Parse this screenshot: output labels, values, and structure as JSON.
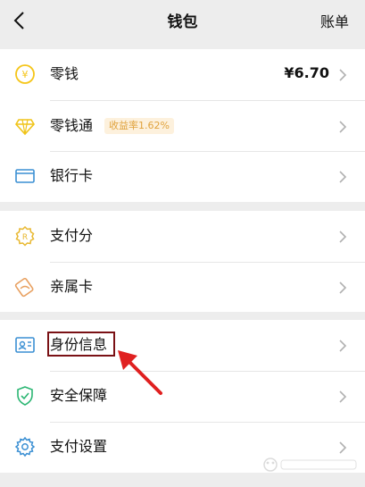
{
  "header": {
    "title": "钱包",
    "bill_label": "账单"
  },
  "sections": [
    {
      "items": [
        {
          "label": "零钱",
          "value": "¥6.70",
          "icon": "yuan-coin-icon"
        },
        {
          "label": "零钱通",
          "badge": "收益率1.62%",
          "icon": "diamond-icon"
        },
        {
          "label": "银行卡",
          "icon": "bank-card-icon"
        }
      ]
    },
    {
      "items": [
        {
          "label": "支付分",
          "icon": "score-badge-icon"
        },
        {
          "label": "亲属卡",
          "icon": "family-card-icon"
        }
      ]
    },
    {
      "items": [
        {
          "label": "身份信息",
          "icon": "id-card-icon"
        },
        {
          "label": "安全保障",
          "icon": "shield-check-icon"
        },
        {
          "label": "支付设置",
          "icon": "gear-icon"
        }
      ]
    }
  ],
  "colors": {
    "page_bg": "#ededed",
    "card_bg": "#ffffff",
    "coin_yellow": "#f5c518",
    "diamond_yellow": "#f0c419",
    "bank_blue": "#3a8fd3",
    "score_yellow": "#e8b830",
    "family_orange": "#e8a060",
    "id_blue": "#3a8fd3",
    "shield_green": "#2bb673",
    "gear_blue": "#3a8fd3",
    "highlight_border": "#7a1115",
    "arrow_red": "#e02020"
  }
}
